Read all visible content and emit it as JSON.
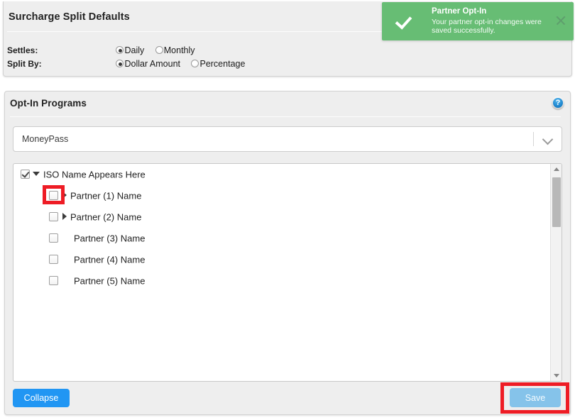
{
  "surcharge_panel": {
    "title": "Surcharge Split Defaults",
    "rows": [
      {
        "label": "Settles:",
        "options": [
          {
            "label": "Daily",
            "selected": true
          },
          {
            "label": "Monthly",
            "selected": false
          }
        ]
      },
      {
        "label": "Split By:",
        "options": [
          {
            "label": "Dollar Amount",
            "selected": true
          },
          {
            "label": "Percentage",
            "selected": false
          }
        ]
      }
    ]
  },
  "optin_panel": {
    "title": "Opt-In Programs",
    "help_icon": "help-circle-icon",
    "program_select": {
      "value": "MoneyPass",
      "chevron_icon": "chevron-down-icon"
    },
    "tree": {
      "root": {
        "label": "ISO Name Appears Here",
        "checked": true,
        "expander": "caret-down-icon"
      },
      "children": [
        {
          "label": "Partner (1) Name",
          "checked": false,
          "expander": "caret-right-icon",
          "highlighted": true
        },
        {
          "label": "Partner (2) Name",
          "checked": false,
          "expander": "caret-right-icon",
          "highlighted": false
        },
        {
          "label": "Partner (3) Name",
          "checked": false,
          "expander": "none",
          "highlighted": false
        },
        {
          "label": "Partner (4) Name",
          "checked": false,
          "expander": "none",
          "highlighted": false
        },
        {
          "label": "Partner (5) Name",
          "checked": false,
          "expander": "none",
          "highlighted": false
        }
      ]
    },
    "scrollbar": {
      "up_icon": "scroll-up-arrow-icon",
      "down_icon": "scroll-down-arrow-icon"
    },
    "buttons": {
      "collapse": "Collapse",
      "save": "Save"
    }
  },
  "toast": {
    "title": "Partner Opt-In",
    "message": "Your partner opt-in changes were saved successfully.",
    "check_icon": "check-icon",
    "close_icon": "close-icon",
    "background_color": "#67bd74"
  },
  "highlights": {
    "color": "#ee1c25",
    "targets": [
      "partner-1-checkbox",
      "save-button"
    ]
  }
}
